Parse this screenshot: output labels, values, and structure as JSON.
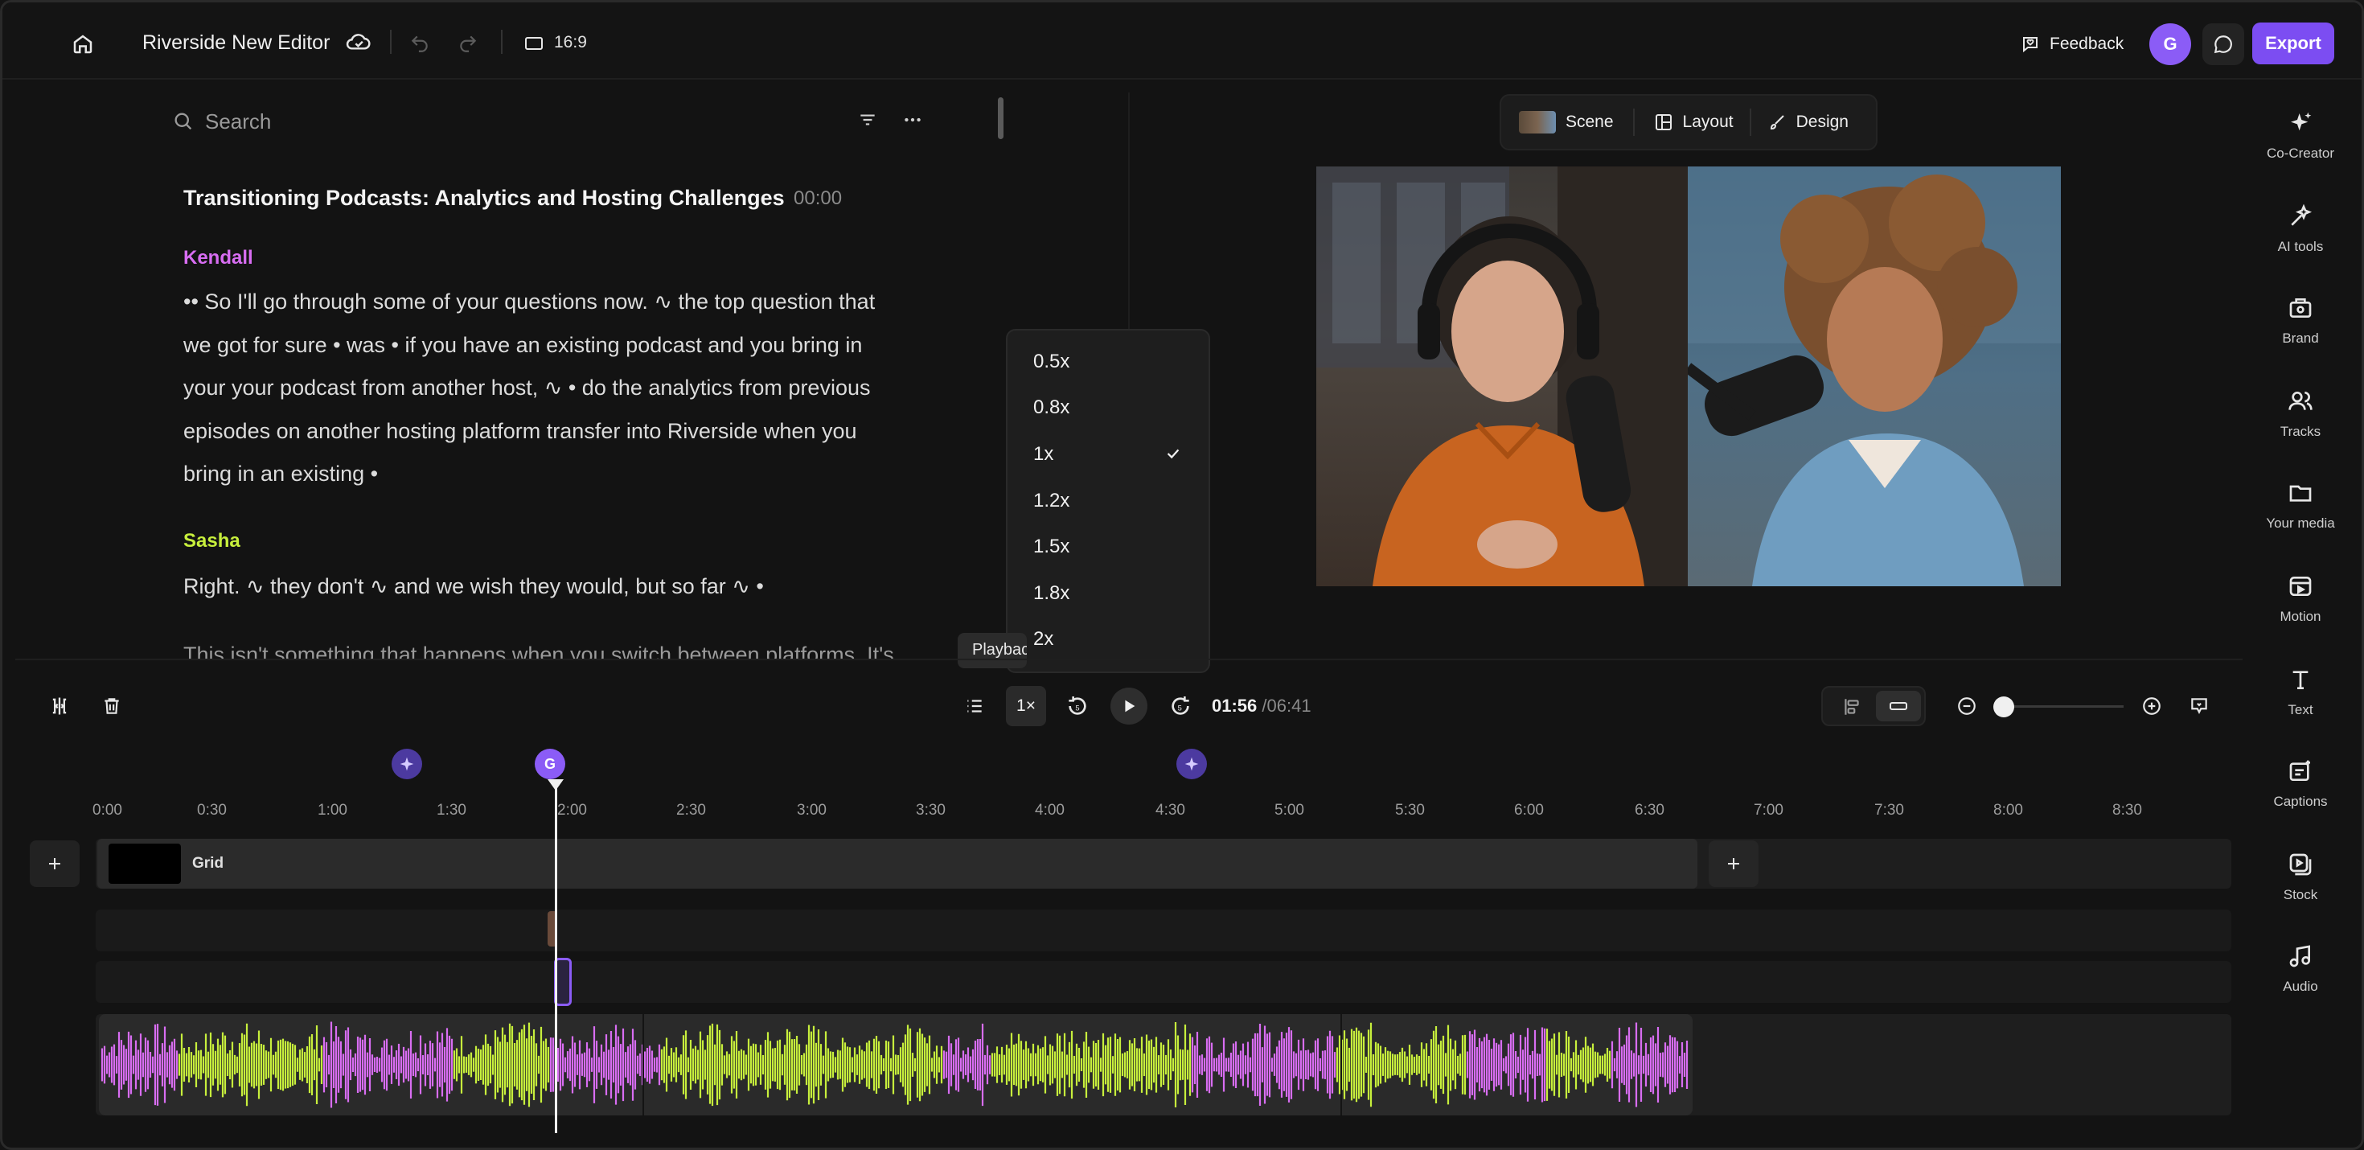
{
  "topbar": {
    "title": "Riverside New Editor",
    "aspect_ratio": "16:9",
    "feedback_label": "Feedback",
    "avatar_initial": "G",
    "export_label": "Export"
  },
  "transcript": {
    "search_placeholder": "Search",
    "title": "Transitioning Podcasts: Analytics and Hosting Challenges",
    "time": "00:00",
    "blocks": [
      {
        "speaker": "Kendall",
        "speaker_color": "#d86df2",
        "text": "•• So I'll go through some of your questions now. ∿ the top question that we got for sure • was • if you have an existing podcast and you bring in your your podcast from another host, ∿ • do the analytics from previous episodes on another hosting platform transfer into Riverside when you bring in an existing •"
      },
      {
        "speaker": "Sasha",
        "speaker_color": "#c7ef3c",
        "text": "Right. ∿ they don't ∿ and we wish they would, but so far ∿ •"
      }
    ],
    "partial_text": "This isn't something that happens when you switch between platforms. It's"
  },
  "preview": {
    "scene_label": "Scene",
    "layout_label": "Layout",
    "design_label": "Design"
  },
  "speed_menu": {
    "options": [
      "0.5x",
      "0.8x",
      "1x",
      "1.2x",
      "1.5x",
      "1.8x",
      "2x"
    ],
    "selected": "1x",
    "tooltip": "Playback speed"
  },
  "playback": {
    "speed": "1×",
    "current_time": "01:56",
    "total_time": "/06:41",
    "zoom_level": 0
  },
  "timeline": {
    "marker_g": "G",
    "ticks": [
      "0:00",
      "0:30",
      "1:00",
      "1:30",
      "2:00",
      "2:30",
      "3:00",
      "3:30",
      "4:00",
      "4:30",
      "5:00",
      "5:30",
      "6:00",
      "6:30",
      "7:00",
      "7:30",
      "8:00",
      "8:30"
    ],
    "grid_label": "Grid",
    "colors": {
      "speaker_a": "#d86df2",
      "speaker_b": "#c7ef3c"
    }
  },
  "rail": {
    "items": [
      {
        "label": "Co-Creator",
        "icon": "sparkle-icon"
      },
      {
        "label": "AI tools",
        "icon": "ai-tools-icon"
      },
      {
        "label": "Brand",
        "icon": "brand-icon"
      },
      {
        "label": "Tracks",
        "icon": "tracks-icon"
      },
      {
        "label": "Your media",
        "icon": "folder-icon"
      },
      {
        "label": "Motion",
        "icon": "motion-icon"
      },
      {
        "label": "Text",
        "icon": "text-icon"
      },
      {
        "label": "Captions",
        "icon": "captions-icon"
      },
      {
        "label": "Stock",
        "icon": "stock-icon"
      },
      {
        "label": "Audio",
        "icon": "music-icon"
      }
    ]
  },
  "accent_color": "#7c4df2"
}
